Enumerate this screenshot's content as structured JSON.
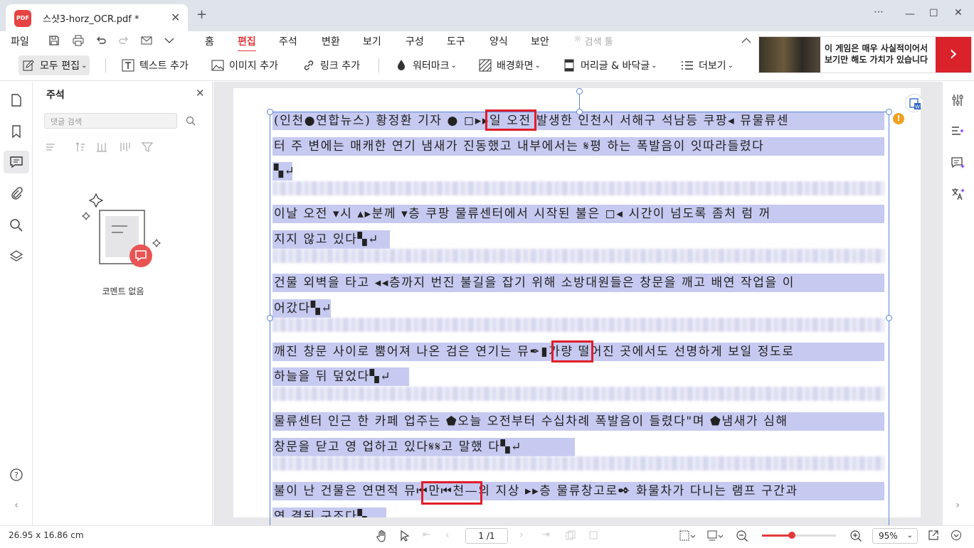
{
  "window": {
    "tab_title": "스샷3-horz_OCR.pdf *",
    "logo_text": "PDF",
    "new_tab": "+",
    "more": "⋯"
  },
  "menu": {
    "file": "파일",
    "items": [
      "홈",
      "편집",
      "주석",
      "변환",
      "보기",
      "구성",
      "도구",
      "양식",
      "보안"
    ],
    "active": "편집",
    "search_tools": "검색 툴"
  },
  "toolbar": {
    "edit_all": "모두 편집",
    "add_text": "텍스트 추가",
    "add_image": "이미지 추가",
    "add_link": "링크 추가",
    "watermark": "워터마크",
    "background": "배경화면",
    "header_footer": "머리글 & 바닥글",
    "more": "더보기"
  },
  "ad": {
    "line1": "이 게임은 매우 사실적이어서",
    "line2": "보기만 해도 가치가 있습니다",
    "arrow": "›"
  },
  "comment_panel": {
    "title": "주석",
    "search_placeholder": "댓글 검색",
    "empty_text": "코멘트 없음"
  },
  "document": {
    "lines": [
      "(인천●연합뉴스) 황정환 기자 ● ◻▸▸일 오전 발생한 인천시 서해구 석남등 쿠팡◂ 뮤물류센",
      "터 주 변에는 매캐한 연기 냄새가 진동했고 내부에서는 𝄋평 하는 폭발음이 잇따라들렸다",
      "▚↵",
      "이날 오전 ▾시 ▴▸분께 ▾층 쿠팡 물류센터에서 시작된 불은 ◻◂ 시간이 넘도록 좀처 럼 꺼",
      "지지 않고 있다▚↵",
      "건물 외벽을 타고 ◂◂층까지 번진 불길을 잡기 위해 소방대원들은 창문을 깨고 배연 작업을 이",
      "어갔다▚↵",
      "깨진 창문 사이로 뿜어져 나온 검은 연기는 뮤✒▮가량 떨어진 곳에서도 선명하게 보일 정도로",
      "하늘을 뒤 덮었다▚↵",
      "물류센터 인근 한 카페 업주는 ⬟오늘 오전부터 수십차례 폭발음이 들렸다\"며 ⬟냄새가 심해",
      "창문을 닫고 영 업하고 있다𝄋𝄋고 말했 다▚↵",
      "불이 난 건물은 연면적 뮤⏮만⏮천—의 지상 ▸▸층 물류창고로✒ 화물차가 다니는 램프 구간과",
      "연 결된 구조다▚"
    ]
  },
  "status": {
    "size": "26.95 x 16.86 cm",
    "page": "1 /1",
    "zoom": "95%",
    "zoom_level": 0.4
  }
}
